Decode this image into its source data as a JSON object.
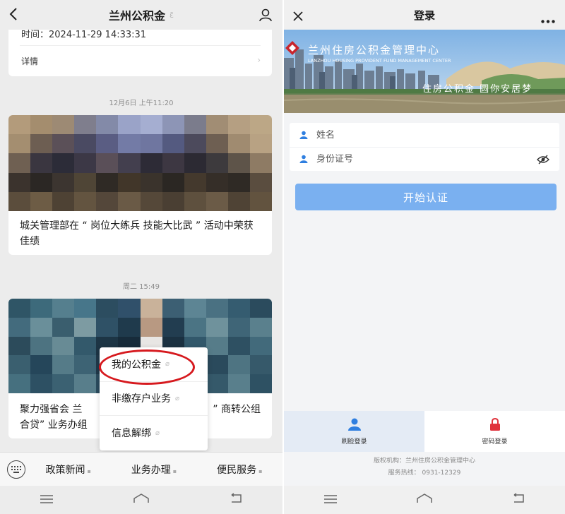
{
  "left": {
    "app_title": "兰州公积金",
    "title_badge": "ε̄",
    "partial_card": {
      "time_text": "时间：2024-11-29 14:33:31",
      "detail_label": "详情"
    },
    "timestamp_1": "12月6日 上午11:20",
    "article_1": {
      "title": "城关管理部在 “ 岗位大练兵 技能大比武 ” 活动中荣获佳绩"
    },
    "timestamp_2": "周二 15:49",
    "article_2": {
      "title_line1": "聚力强省会 兰",
      "title_line1_tail": "” 商转公组",
      "title_line2": "合贷” 业务办组"
    },
    "menu": {
      "items": [
        "我的公积金",
        "非缴存户业务",
        "信息解绑"
      ]
    },
    "bottom_nav": [
      "政策新闻",
      "业务办理",
      "便民服务"
    ]
  },
  "right": {
    "page_title": "登录",
    "banner": {
      "org_name": "兰州住房公积金管理中心",
      "org_name_en": "LANZHOU HOUSING PROVIDENT FUND MANAGEMENT CENTER",
      "slogan": "住房公积金 圆你安居梦"
    },
    "form": {
      "name_placeholder": "姓名",
      "id_placeholder": "身份证号"
    },
    "start_button": "开始认证",
    "tabs": {
      "face_login": "刷脸登录",
      "password_login": "密码登录"
    },
    "footer": {
      "copyright": "版权机构：兰州住房公积金管理中心",
      "hotline": "服务热线： 0931-12329"
    }
  },
  "colors": {
    "accent_blue": "#7ab0f0",
    "highlight_red": "#d6191e",
    "lock_red": "#e0323c"
  },
  "icons": [
    "back-icon",
    "user-icon",
    "close-icon",
    "more-icon",
    "person-icon",
    "eye-off-icon",
    "face-icon",
    "lock-icon",
    "keyboard-icon",
    "menu-icon",
    "home-icon",
    "return-icon",
    "link-icon"
  ]
}
